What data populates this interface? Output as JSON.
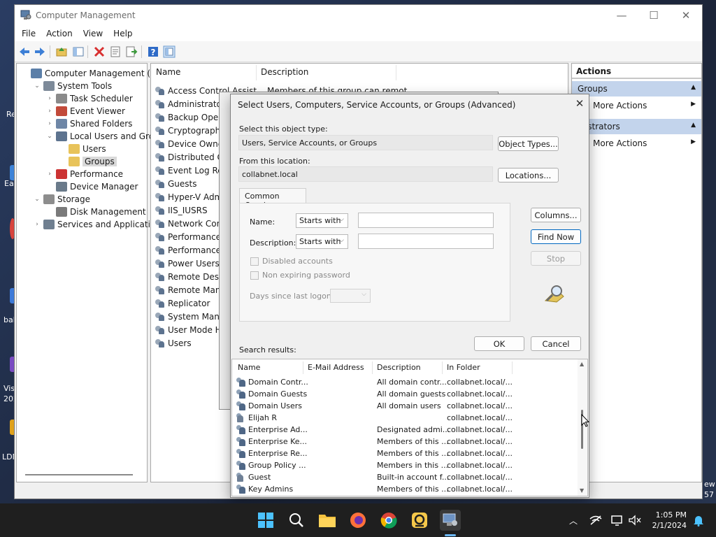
{
  "window": {
    "title": "Computer Management",
    "minimize": "—",
    "maximize": "☐",
    "close": "✕"
  },
  "menu": [
    "File",
    "Action",
    "View",
    "Help"
  ],
  "tree": [
    {
      "label": "Computer Management (Local",
      "depth": 0,
      "chev": "",
      "sel": false
    },
    {
      "label": "System Tools",
      "depth": 1,
      "chev": "⌄",
      "sel": false
    },
    {
      "label": "Task Scheduler",
      "depth": 2,
      "chev": "›",
      "sel": false
    },
    {
      "label": "Event Viewer",
      "depth": 2,
      "chev": "›",
      "sel": false
    },
    {
      "label": "Shared Folders",
      "depth": 2,
      "chev": "›",
      "sel": false
    },
    {
      "label": "Local Users and Groups",
      "depth": 2,
      "chev": "⌄",
      "sel": false
    },
    {
      "label": "Users",
      "depth": 3,
      "chev": "",
      "sel": false
    },
    {
      "label": "Groups",
      "depth": 3,
      "chev": "",
      "sel": true
    },
    {
      "label": "Performance",
      "depth": 2,
      "chev": "›",
      "sel": false
    },
    {
      "label": "Device Manager",
      "depth": 2,
      "chev": "",
      "sel": false
    },
    {
      "label": "Storage",
      "depth": 1,
      "chev": "⌄",
      "sel": false
    },
    {
      "label": "Disk Management",
      "depth": 2,
      "chev": "",
      "sel": false
    },
    {
      "label": "Services and Applications",
      "depth": 1,
      "chev": "›",
      "sel": false
    }
  ],
  "list": {
    "headers": [
      "Name",
      "Description"
    ],
    "rows": [
      {
        "name": "Access Control Assist...",
        "desc": "Members of this group can remot..."
      },
      {
        "name": "Administrators",
        "desc": ""
      },
      {
        "name": "Backup Operat",
        "desc": ""
      },
      {
        "name": "Cryptographic",
        "desc": ""
      },
      {
        "name": "Device Owners",
        "desc": ""
      },
      {
        "name": "Distributed CO",
        "desc": ""
      },
      {
        "name": "Event Log Rea",
        "desc": ""
      },
      {
        "name": "Guests",
        "desc": ""
      },
      {
        "name": "Hyper-V Admi",
        "desc": ""
      },
      {
        "name": "IIS_IUSRS",
        "desc": ""
      },
      {
        "name": "Network Confi",
        "desc": ""
      },
      {
        "name": "Performance L",
        "desc": ""
      },
      {
        "name": "Performance M",
        "desc": ""
      },
      {
        "name": "Power Users",
        "desc": ""
      },
      {
        "name": "Remote Deskto",
        "desc": ""
      },
      {
        "name": "Remote Manag",
        "desc": ""
      },
      {
        "name": "Replicator",
        "desc": ""
      },
      {
        "name": "System Manag",
        "desc": ""
      },
      {
        "name": "User Mode Ha",
        "desc": ""
      },
      {
        "name": "Users",
        "desc": ""
      }
    ]
  },
  "actions": {
    "header": "Actions",
    "section1": "Groups",
    "item1": "More Actions",
    "section2": "inistrators",
    "item2": "More Actions"
  },
  "dialog": {
    "title": "Select Users, Computers, Service Accounts, or Groups (Advanced)",
    "object_type_label": "Select this object type:",
    "object_type_value": "Users, Service Accounts, or Groups",
    "object_types_btn": "Object Types...",
    "location_label": "From this location:",
    "location_value": "collabnet.local",
    "locations_btn": "Locations...",
    "tab": "Common Queries",
    "name_label": "Name:",
    "name_mode": "Starts with",
    "desc_label": "Description:",
    "desc_mode": "Starts with",
    "disabled_accounts": "Disabled accounts",
    "non_expiring": "Non expiring password",
    "days_label": "Days since last logon:",
    "columns_btn": "Columns...",
    "find_now_btn": "Find Now",
    "stop_btn": "Stop",
    "ok_btn": "OK",
    "cancel_btn": "Cancel",
    "results_label": "Search results:",
    "result_headers": [
      "Name",
      "E-Mail Address",
      "Description",
      "In Folder"
    ],
    "results": [
      {
        "name": "Domain Contr...",
        "email": "",
        "desc": "All domain contr...",
        "folder": "collabnet.local/...",
        "kind": "group"
      },
      {
        "name": "Domain Guests",
        "email": "",
        "desc": "All domain guests",
        "folder": "collabnet.local/...",
        "kind": "group"
      },
      {
        "name": "Domain Users",
        "email": "",
        "desc": "All domain users",
        "folder": "collabnet.local/...",
        "kind": "group"
      },
      {
        "name": "Elijah R",
        "email": "",
        "desc": "",
        "folder": "collabnet.local/...",
        "kind": "user"
      },
      {
        "name": "Enterprise Ad...",
        "email": "",
        "desc": "Designated admi...",
        "folder": "collabnet.local/...",
        "kind": "group"
      },
      {
        "name": "Enterprise Ke...",
        "email": "",
        "desc": "Members of this ...",
        "folder": "collabnet.local/...",
        "kind": "group"
      },
      {
        "name": "Enterprise Re...",
        "email": "",
        "desc": "Members of this ...",
        "folder": "collabnet.local/...",
        "kind": "group"
      },
      {
        "name": "Group Policy ...",
        "email": "",
        "desc": "Members in this ...",
        "folder": "collabnet.local/...",
        "kind": "group"
      },
      {
        "name": "Guest",
        "email": "",
        "desc": "Built-in account f...",
        "folder": "collabnet.local/...",
        "kind": "user"
      },
      {
        "name": "Key Admins",
        "email": "",
        "desc": "Members of this ...",
        "folder": "collabnet.local/...",
        "kind": "group"
      }
    ]
  },
  "desktop_labels": [
    "Re",
    "Eas",
    "bal",
    "Vis",
    "202",
    "LDN",
    "ew",
    "57"
  ],
  "taskbar": {
    "time": "1:05 PM",
    "date": "2/1/2024"
  }
}
